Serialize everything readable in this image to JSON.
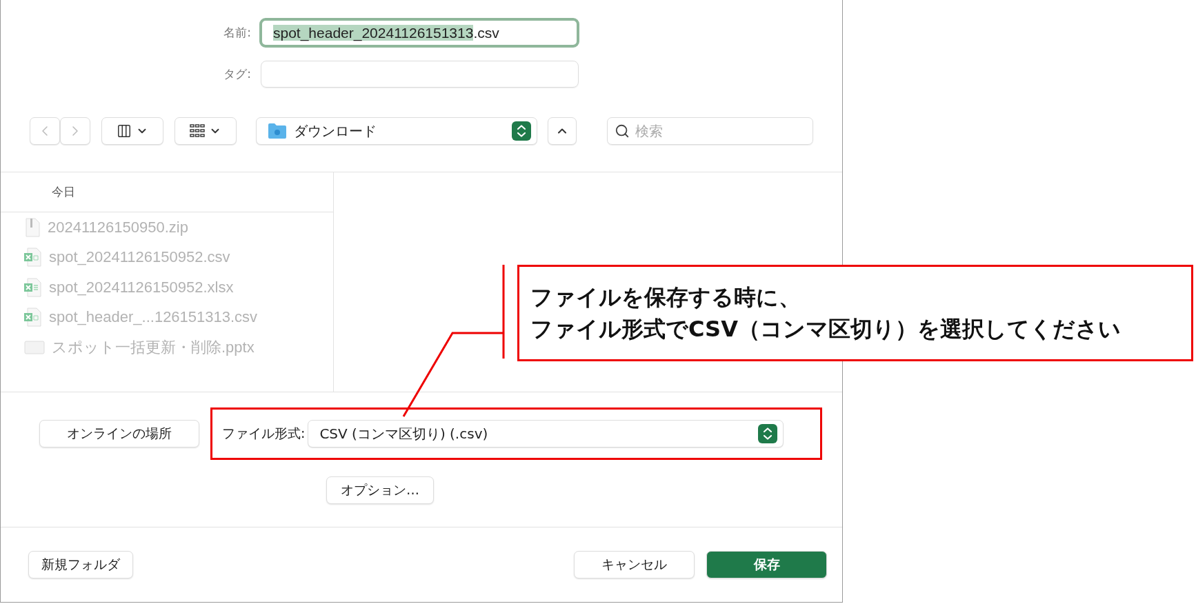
{
  "dialog": {
    "name_label": "名前:",
    "name_field": {
      "selected_text": "spot_header_20241126151313",
      "rest_text": ".csv",
      "focused": true
    },
    "tag_label": "タグ:",
    "location": "ダウンロード",
    "search_placeholder": "検索",
    "file_list": {
      "header": "今日",
      "items": [
        {
          "name": "20241126150950.zip",
          "kind": "zip",
          "disabled": true
        },
        {
          "name": "spot_20241126150952.csv",
          "kind": "csv",
          "disabled": true
        },
        {
          "name": "spot_20241126150952.xlsx",
          "kind": "xlsx",
          "disabled": true
        },
        {
          "name": "spot_header_...126151313.csv",
          "kind": "csv",
          "disabled": true
        },
        {
          "name": "スポット一括更新・削除.pptx",
          "kind": "pptx",
          "disabled": true
        }
      ]
    },
    "online_button": "オンラインの場所",
    "format": {
      "label": "ファイル形式:",
      "value": "CSV (コンマ区切り) (.csv)",
      "highlighted": true
    },
    "options_button": "オプション…",
    "new_folder_button": "新規フォルダ",
    "buttons": [
      {
        "label": "キャンセル",
        "kind": "secondary"
      },
      {
        "label": "保存",
        "kind": "primary"
      }
    ]
  },
  "callout": {
    "lines": [
      "ファイルを保存する時に、",
      "ファイル形式でCSV（コンマ区切り）を選択してください"
    ]
  }
}
